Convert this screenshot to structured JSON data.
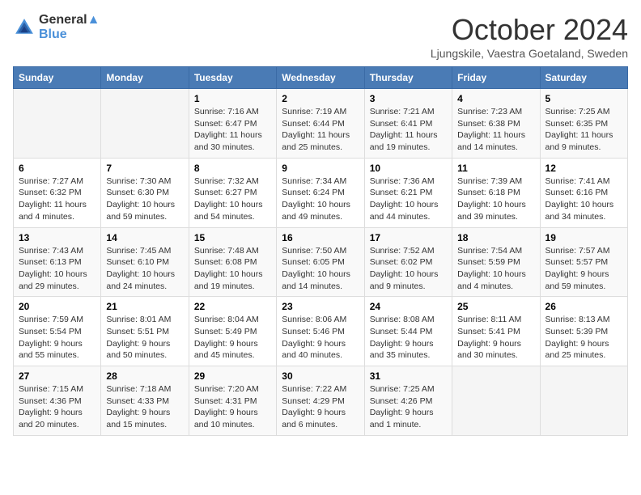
{
  "header": {
    "logo_line1": "General",
    "logo_line2": "Blue",
    "month": "October 2024",
    "location": "Ljungskile, Vaestra Goetaland, Sweden"
  },
  "weekdays": [
    "Sunday",
    "Monday",
    "Tuesday",
    "Wednesday",
    "Thursday",
    "Friday",
    "Saturday"
  ],
  "weeks": [
    [
      {
        "day": "",
        "empty": true
      },
      {
        "day": "",
        "empty": true
      },
      {
        "day": "1",
        "sunrise": "Sunrise: 7:16 AM",
        "sunset": "Sunset: 6:47 PM",
        "daylight": "Daylight: 11 hours and 30 minutes."
      },
      {
        "day": "2",
        "sunrise": "Sunrise: 7:19 AM",
        "sunset": "Sunset: 6:44 PM",
        "daylight": "Daylight: 11 hours and 25 minutes."
      },
      {
        "day": "3",
        "sunrise": "Sunrise: 7:21 AM",
        "sunset": "Sunset: 6:41 PM",
        "daylight": "Daylight: 11 hours and 19 minutes."
      },
      {
        "day": "4",
        "sunrise": "Sunrise: 7:23 AM",
        "sunset": "Sunset: 6:38 PM",
        "daylight": "Daylight: 11 hours and 14 minutes."
      },
      {
        "day": "5",
        "sunrise": "Sunrise: 7:25 AM",
        "sunset": "Sunset: 6:35 PM",
        "daylight": "Daylight: 11 hours and 9 minutes."
      }
    ],
    [
      {
        "day": "6",
        "sunrise": "Sunrise: 7:27 AM",
        "sunset": "Sunset: 6:32 PM",
        "daylight": "Daylight: 11 hours and 4 minutes."
      },
      {
        "day": "7",
        "sunrise": "Sunrise: 7:30 AM",
        "sunset": "Sunset: 6:30 PM",
        "daylight": "Daylight: 10 hours and 59 minutes."
      },
      {
        "day": "8",
        "sunrise": "Sunrise: 7:32 AM",
        "sunset": "Sunset: 6:27 PM",
        "daylight": "Daylight: 10 hours and 54 minutes."
      },
      {
        "day": "9",
        "sunrise": "Sunrise: 7:34 AM",
        "sunset": "Sunset: 6:24 PM",
        "daylight": "Daylight: 10 hours and 49 minutes."
      },
      {
        "day": "10",
        "sunrise": "Sunrise: 7:36 AM",
        "sunset": "Sunset: 6:21 PM",
        "daylight": "Daylight: 10 hours and 44 minutes."
      },
      {
        "day": "11",
        "sunrise": "Sunrise: 7:39 AM",
        "sunset": "Sunset: 6:18 PM",
        "daylight": "Daylight: 10 hours and 39 minutes."
      },
      {
        "day": "12",
        "sunrise": "Sunrise: 7:41 AM",
        "sunset": "Sunset: 6:16 PM",
        "daylight": "Daylight: 10 hours and 34 minutes."
      }
    ],
    [
      {
        "day": "13",
        "sunrise": "Sunrise: 7:43 AM",
        "sunset": "Sunset: 6:13 PM",
        "daylight": "Daylight: 10 hours and 29 minutes."
      },
      {
        "day": "14",
        "sunrise": "Sunrise: 7:45 AM",
        "sunset": "Sunset: 6:10 PM",
        "daylight": "Daylight: 10 hours and 24 minutes."
      },
      {
        "day": "15",
        "sunrise": "Sunrise: 7:48 AM",
        "sunset": "Sunset: 6:08 PM",
        "daylight": "Daylight: 10 hours and 19 minutes."
      },
      {
        "day": "16",
        "sunrise": "Sunrise: 7:50 AM",
        "sunset": "Sunset: 6:05 PM",
        "daylight": "Daylight: 10 hours and 14 minutes."
      },
      {
        "day": "17",
        "sunrise": "Sunrise: 7:52 AM",
        "sunset": "Sunset: 6:02 PM",
        "daylight": "Daylight: 10 hours and 9 minutes."
      },
      {
        "day": "18",
        "sunrise": "Sunrise: 7:54 AM",
        "sunset": "Sunset: 5:59 PM",
        "daylight": "Daylight: 10 hours and 4 minutes."
      },
      {
        "day": "19",
        "sunrise": "Sunrise: 7:57 AM",
        "sunset": "Sunset: 5:57 PM",
        "daylight": "Daylight: 9 hours and 59 minutes."
      }
    ],
    [
      {
        "day": "20",
        "sunrise": "Sunrise: 7:59 AM",
        "sunset": "Sunset: 5:54 PM",
        "daylight": "Daylight: 9 hours and 55 minutes."
      },
      {
        "day": "21",
        "sunrise": "Sunrise: 8:01 AM",
        "sunset": "Sunset: 5:51 PM",
        "daylight": "Daylight: 9 hours and 50 minutes."
      },
      {
        "day": "22",
        "sunrise": "Sunrise: 8:04 AM",
        "sunset": "Sunset: 5:49 PM",
        "daylight": "Daylight: 9 hours and 45 minutes."
      },
      {
        "day": "23",
        "sunrise": "Sunrise: 8:06 AM",
        "sunset": "Sunset: 5:46 PM",
        "daylight": "Daylight: 9 hours and 40 minutes."
      },
      {
        "day": "24",
        "sunrise": "Sunrise: 8:08 AM",
        "sunset": "Sunset: 5:44 PM",
        "daylight": "Daylight: 9 hours and 35 minutes."
      },
      {
        "day": "25",
        "sunrise": "Sunrise: 8:11 AM",
        "sunset": "Sunset: 5:41 PM",
        "daylight": "Daylight: 9 hours and 30 minutes."
      },
      {
        "day": "26",
        "sunrise": "Sunrise: 8:13 AM",
        "sunset": "Sunset: 5:39 PM",
        "daylight": "Daylight: 9 hours and 25 minutes."
      }
    ],
    [
      {
        "day": "27",
        "sunrise": "Sunrise: 7:15 AM",
        "sunset": "Sunset: 4:36 PM",
        "daylight": "Daylight: 9 hours and 20 minutes."
      },
      {
        "day": "28",
        "sunrise": "Sunrise: 7:18 AM",
        "sunset": "Sunset: 4:33 PM",
        "daylight": "Daylight: 9 hours and 15 minutes."
      },
      {
        "day": "29",
        "sunrise": "Sunrise: 7:20 AM",
        "sunset": "Sunset: 4:31 PM",
        "daylight": "Daylight: 9 hours and 10 minutes."
      },
      {
        "day": "30",
        "sunrise": "Sunrise: 7:22 AM",
        "sunset": "Sunset: 4:29 PM",
        "daylight": "Daylight: 9 hours and 6 minutes."
      },
      {
        "day": "31",
        "sunrise": "Sunrise: 7:25 AM",
        "sunset": "Sunset: 4:26 PM",
        "daylight": "Daylight: 9 hours and 1 minute."
      },
      {
        "day": "",
        "empty": true
      },
      {
        "day": "",
        "empty": true
      }
    ]
  ]
}
